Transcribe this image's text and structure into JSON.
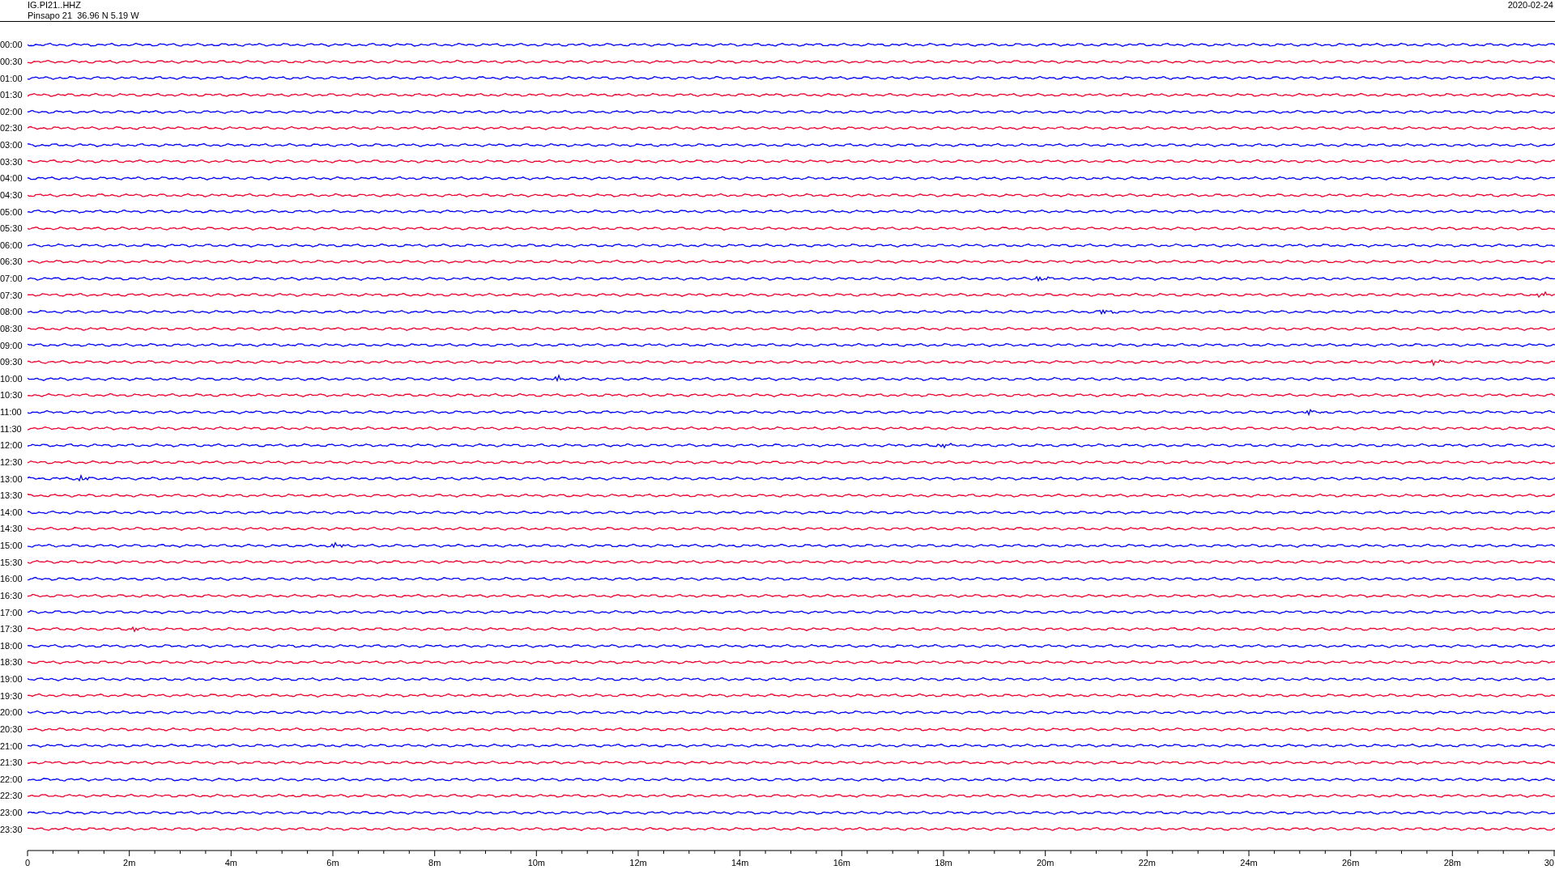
{
  "header": {
    "channel": "IG.PI21..HHZ",
    "station": "Pinsapo 21  36.96 N 5.19 W",
    "date": "2020-02-24"
  },
  "rows": [
    {
      "label": "00:00",
      "color": "#0000ff"
    },
    {
      "label": "00:30",
      "color": "#f0002e"
    },
    {
      "label": "01:00",
      "color": "#0000ff"
    },
    {
      "label": "01:30",
      "color": "#f0002e"
    },
    {
      "label": "02:00",
      "color": "#0000ff"
    },
    {
      "label": "02:30",
      "color": "#f0002e"
    },
    {
      "label": "03:00",
      "color": "#0000ff"
    },
    {
      "label": "03:30",
      "color": "#f0002e"
    },
    {
      "label": "04:00",
      "color": "#0000ff"
    },
    {
      "label": "04:30",
      "color": "#f0002e"
    },
    {
      "label": "05:00",
      "color": "#0000ff"
    },
    {
      "label": "05:30",
      "color": "#f0002e"
    },
    {
      "label": "06:00",
      "color": "#0000ff"
    },
    {
      "label": "06:30",
      "color": "#f0002e"
    },
    {
      "label": "07:00",
      "color": "#0000ff"
    },
    {
      "label": "07:30",
      "color": "#f0002e"
    },
    {
      "label": "08:00",
      "color": "#0000ff"
    },
    {
      "label": "08:30",
      "color": "#f0002e"
    },
    {
      "label": "09:00",
      "color": "#0000ff"
    },
    {
      "label": "09:30",
      "color": "#f0002e"
    },
    {
      "label": "10:00",
      "color": "#0000ff"
    },
    {
      "label": "10:30",
      "color": "#f0002e"
    },
    {
      "label": "11:00",
      "color": "#0000ff"
    },
    {
      "label": "11:30",
      "color": "#f0002e"
    },
    {
      "label": "12:00",
      "color": "#0000ff"
    },
    {
      "label": "12:30",
      "color": "#f0002e"
    },
    {
      "label": "13:00",
      "color": "#0000ff"
    },
    {
      "label": "13:30",
      "color": "#f0002e"
    },
    {
      "label": "14:00",
      "color": "#0000ff"
    },
    {
      "label": "14:30",
      "color": "#f0002e"
    },
    {
      "label": "15:00",
      "color": "#0000ff"
    },
    {
      "label": "15:30",
      "color": "#f0002e"
    },
    {
      "label": "16:00",
      "color": "#0000ff"
    },
    {
      "label": "16:30",
      "color": "#f0002e"
    },
    {
      "label": "17:00",
      "color": "#0000ff"
    },
    {
      "label": "17:30",
      "color": "#f0002e"
    },
    {
      "label": "18:00",
      "color": "#0000ff"
    },
    {
      "label": "18:30",
      "color": "#f0002e"
    },
    {
      "label": "19:00",
      "color": "#0000ff"
    },
    {
      "label": "19:30",
      "color": "#f0002e"
    },
    {
      "label": "20:00",
      "color": "#0000ff"
    },
    {
      "label": "20:30",
      "color": "#f0002e"
    },
    {
      "label": "21:00",
      "color": "#0000ff"
    },
    {
      "label": "21:30",
      "color": "#f0002e"
    },
    {
      "label": "22:00",
      "color": "#0000ff"
    },
    {
      "label": "22:30",
      "color": "#f0002e"
    },
    {
      "label": "23:00",
      "color": "#0000ff"
    },
    {
      "label": "23:30",
      "color": "#f0002e"
    }
  ],
  "axis": {
    "ticks": [
      "0",
      "2m",
      "4m",
      "6m",
      "8m",
      "10m",
      "12m",
      "14m",
      "16m",
      "18m",
      "20m",
      "22m",
      "24m",
      "26m",
      "28m",
      "30"
    ]
  }
}
